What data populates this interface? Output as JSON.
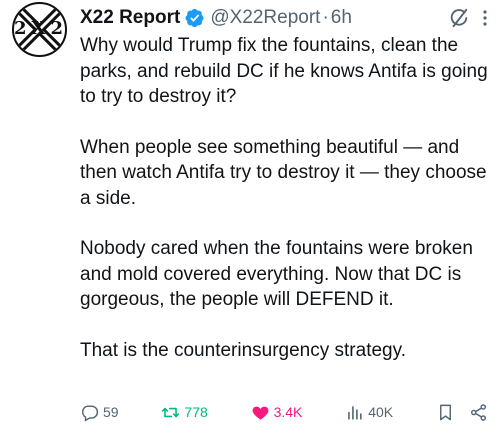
{
  "author": {
    "display_name": "X22 Report",
    "handle": "@X22Report",
    "separator": "·",
    "time": "6h",
    "avatar_text": "2X2"
  },
  "post": {
    "paragraphs": [
      "Why would Trump fix the fountains, clean the parks, and rebuild DC if he knows Antifa is going to try to destroy it?",
      "When people see something beautiful — and then watch Antifa try to destroy it — they choose a side.",
      "Nobody cared when the fountains were broken and mold covered everything. Now that DC is gorgeous, the people will DEFEND it.",
      "That is the counterinsurgency strategy."
    ]
  },
  "actions": {
    "replies": "59",
    "reposts": "778",
    "likes": "3.4K",
    "views": "40K"
  },
  "icons": {
    "verified": "verified-badge-icon",
    "grok": "grok-icon",
    "more": "more-icon",
    "reply": "reply-icon",
    "repost": "repost-icon",
    "like": "heart-icon",
    "views": "views-icon",
    "bookmark": "bookmark-icon",
    "share": "share-icon"
  },
  "colors": {
    "text": "#0f1419",
    "muted": "#536471",
    "verified": "#1d9bf0",
    "repost_active": "#00ba7c",
    "like_active": "#f91880"
  }
}
